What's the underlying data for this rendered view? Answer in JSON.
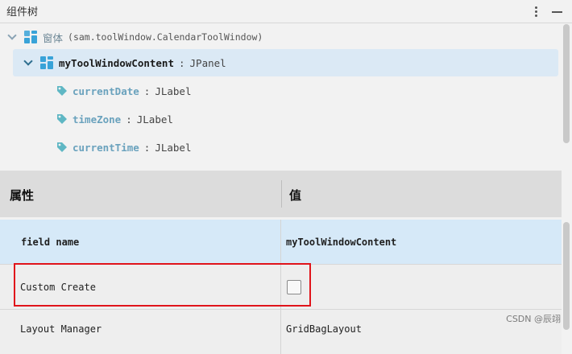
{
  "header": {
    "title": "组件树"
  },
  "tree": {
    "root": {
      "name": "窗体",
      "detail": "(sam.toolWindow.CalendarToolWindow)"
    },
    "panel": {
      "name": "myToolWindowContent",
      "separator": ":",
      "type": "JPanel"
    },
    "children": [
      {
        "name": "currentDate",
        "separator": ":",
        "type": "JLabel"
      },
      {
        "name": "timeZone",
        "separator": ":",
        "type": "JLabel"
      },
      {
        "name": "currentTime",
        "separator": ":",
        "type": "JLabel"
      }
    ]
  },
  "properties": {
    "columns": {
      "property": "属性",
      "value": "值"
    },
    "rows": [
      {
        "name": "field name",
        "value": "myToolWindowContent"
      },
      {
        "name": "Custom Create",
        "value": ""
      },
      {
        "name": "Layout Manager",
        "value": "GridBagLayout"
      }
    ]
  },
  "watermark": "CSDN @辰翊",
  "colors": {
    "selection": "#dbe9f5",
    "highlight_row": "#d6e9f8",
    "annotation_red": "#e0141b",
    "icon_blue": "#39a3d8",
    "tag_teal": "#5fb7c4"
  }
}
